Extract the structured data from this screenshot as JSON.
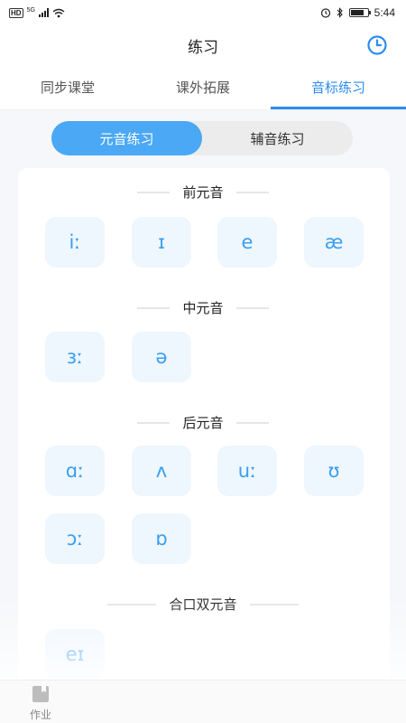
{
  "status_bar": {
    "hd": "HD",
    "network": "5G",
    "time": "5:44",
    "battery_level": 0.8
  },
  "header": {
    "title": "练习",
    "history_icon": "history-clock-icon"
  },
  "tabs": [
    {
      "label": "同步课堂",
      "active": false
    },
    {
      "label": "课外拓展",
      "active": false
    },
    {
      "label": "音标练习",
      "active": true
    }
  ],
  "segment": {
    "vowel": "元音练习",
    "consonant": "辅音练习",
    "selected": "vowel"
  },
  "sections": [
    {
      "title": "前元音",
      "items": [
        "iː",
        "ɪ",
        "e",
        "æ"
      ]
    },
    {
      "title": "中元音",
      "items": [
        "ɜː",
        "ə"
      ]
    },
    {
      "title": "后元音",
      "items": [
        "ɑː",
        "ʌ",
        "uː",
        "ʊ",
        "ɔː",
        "ɒ"
      ]
    },
    {
      "title": "合口双元音",
      "items": [
        "eɪ"
      ]
    }
  ],
  "bottom_nav": {
    "homework": {
      "label": "作业",
      "icon": "homework-book-icon"
    }
  },
  "colors": {
    "accent": "#2d8cf0",
    "segment_active": "#4aa8f5",
    "phoneme_text": "#3a9ff0",
    "phoneme_bg": "#eef6fe"
  }
}
